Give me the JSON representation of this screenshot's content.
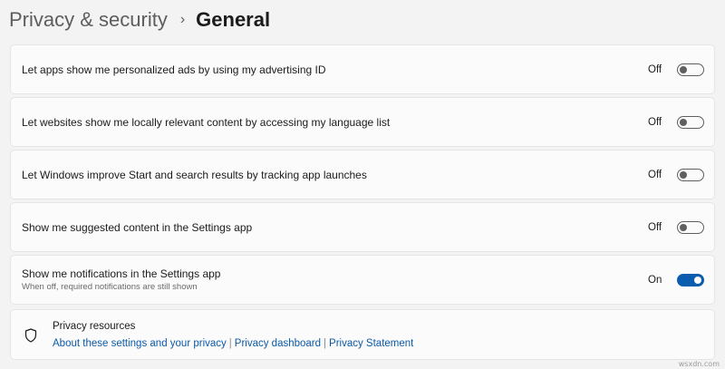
{
  "breadcrumb": {
    "parent": "Privacy & security",
    "separator": "›",
    "current": "General"
  },
  "settings": [
    {
      "label": "Let apps show me personalized ads by using my advertising ID",
      "sublabel": "",
      "state": "Off",
      "on": false
    },
    {
      "label": "Let websites show me locally relevant content by accessing my language list",
      "sublabel": "",
      "state": "Off",
      "on": false
    },
    {
      "label": "Let Windows improve Start and search results by tracking app launches",
      "sublabel": "",
      "state": "Off",
      "on": false
    },
    {
      "label": "Show me suggested content in the Settings app",
      "sublabel": "",
      "state": "Off",
      "on": false
    },
    {
      "label": "Show me notifications in the Settings app",
      "sublabel": "When off, required notifications are still shown",
      "state": "On",
      "on": true
    }
  ],
  "resources": {
    "icon": "shield-icon",
    "title": "Privacy resources",
    "links": [
      "About these settings and your privacy",
      "Privacy dashboard",
      "Privacy Statement"
    ],
    "separator": "|"
  },
  "colors": {
    "accent": "#0a5cae",
    "link": "#0a5aa8",
    "background": "#f3f3f3",
    "card": "#fbfbfb"
  },
  "watermark": "wsxdn.com"
}
